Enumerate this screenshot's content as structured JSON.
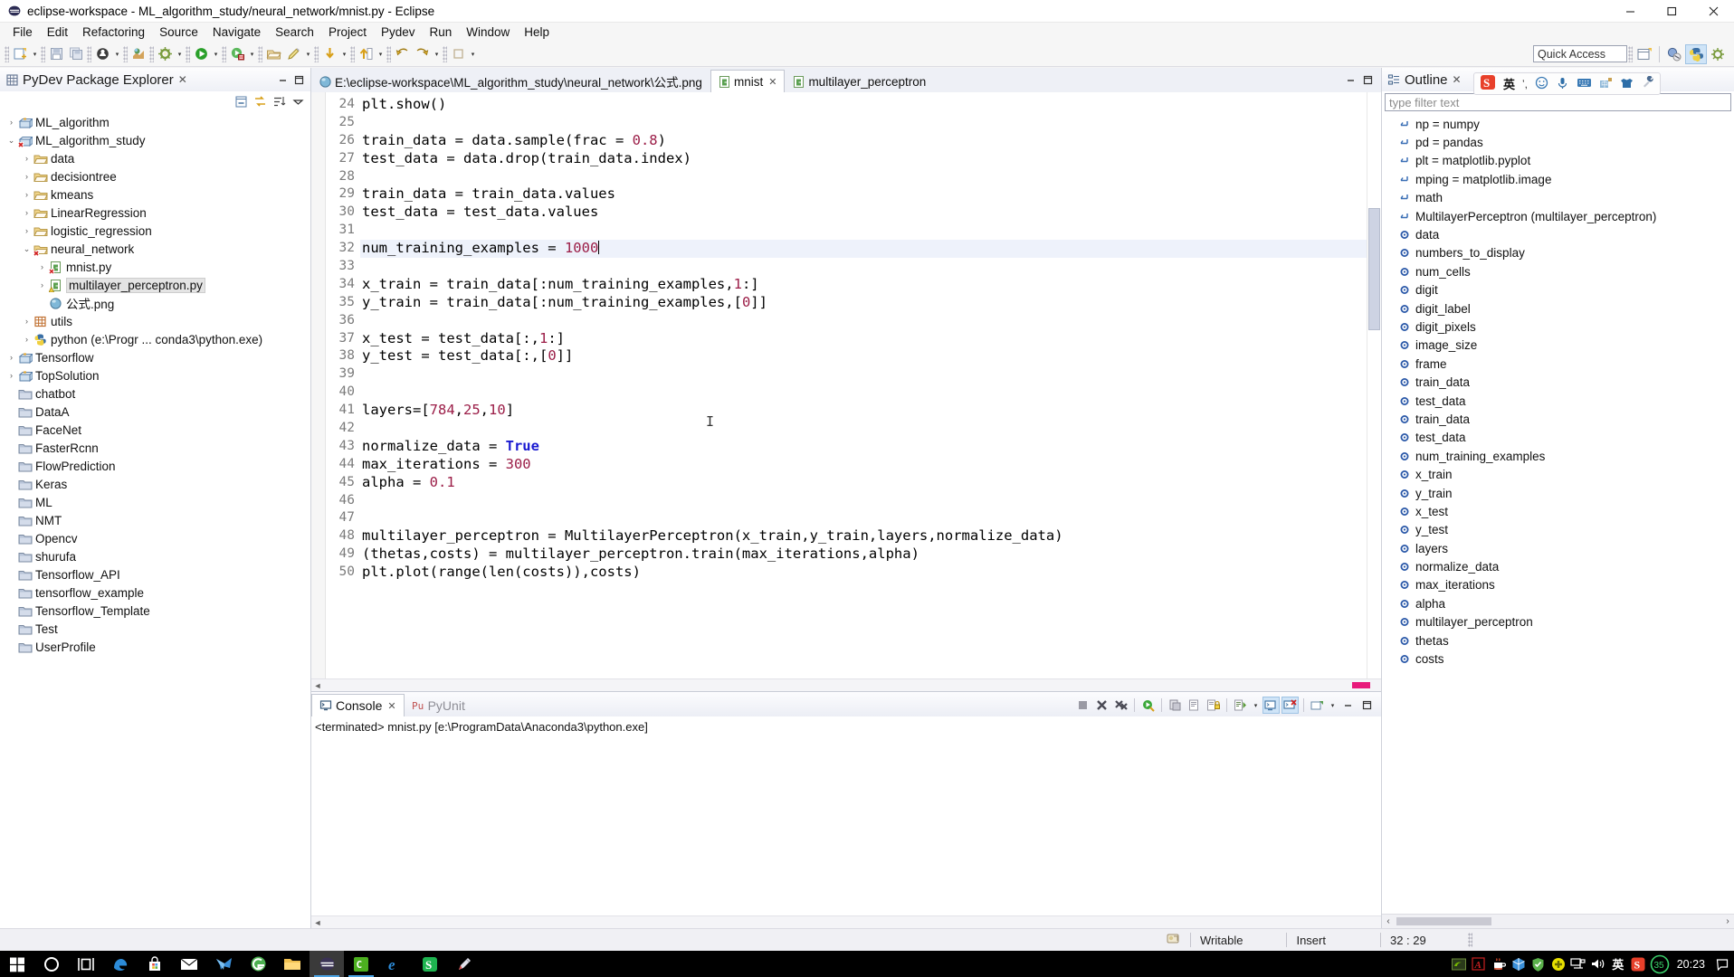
{
  "window": {
    "title": "eclipse-workspace - ML_algorithm_study/neural_network/mnist.py - Eclipse",
    "icon": "eclipse-icon",
    "minimize": "minimize-button",
    "maximize": "maximize-button",
    "close": "close-button"
  },
  "menubar": {
    "items": [
      "File",
      "Edit",
      "Refactoring",
      "Source",
      "Navigate",
      "Search",
      "Project",
      "Pydev",
      "Run",
      "Window",
      "Help"
    ]
  },
  "toolbar": {
    "quick_access_placeholder": "Quick Access",
    "buttons": [
      "new-wizard-icon",
      "save-icon",
      "save-all-icon",
      "print-icon",
      "globe-icon",
      "build-icon",
      "run-icon",
      "debug-icon",
      "open-type-icon",
      "pencil-icon",
      "next-annotation-icon",
      "previous-annotation-icon",
      "back-icon",
      "forward-icon",
      "pin-icon"
    ],
    "perspectives": [
      "open-perspective-icon",
      "java-perspective-icon",
      "pydev-perspective-icon",
      "debug-perspective-icon"
    ]
  },
  "explorer": {
    "title": "PyDev Package Explorer",
    "icon": "package-explorer-icon",
    "close_glyph": "✕",
    "header_tools": [
      "minimize-icon",
      "maximize-icon"
    ],
    "subtools": [
      "collapse-all-icon",
      "link-with-editor-icon",
      "sort-icon",
      "view-menu-icon"
    ],
    "tree": [
      {
        "label": "ML_algorithm",
        "indent": 0,
        "twist": "collapsed",
        "icon": "project-icon"
      },
      {
        "label": "ML_algorithm_study",
        "indent": 0,
        "twist": "expanded",
        "icon": "project-error-icon"
      },
      {
        "label": "data",
        "indent": 1,
        "twist": "collapsed",
        "icon": "folder-icon"
      },
      {
        "label": "decisiontree",
        "indent": 1,
        "twist": "collapsed",
        "icon": "folder-icon"
      },
      {
        "label": "kmeans",
        "indent": 1,
        "twist": "collapsed",
        "icon": "folder-icon"
      },
      {
        "label": "LinearRegression",
        "indent": 1,
        "twist": "collapsed",
        "icon": "folder-icon"
      },
      {
        "label": "logistic_regression",
        "indent": 1,
        "twist": "collapsed",
        "icon": "folder-icon"
      },
      {
        "label": "neural_network",
        "indent": 1,
        "twist": "expanded",
        "icon": "folder-error-icon"
      },
      {
        "label": "mnist.py",
        "indent": 2,
        "twist": "collapsed",
        "icon": "python-error-file-icon"
      },
      {
        "label": "multilayer_perceptron.py",
        "indent": 2,
        "twist": "collapsed",
        "icon": "python-warn-file-icon",
        "selected": true
      },
      {
        "label": "公式.png",
        "indent": 2,
        "twist": "none",
        "icon": "image-file-icon"
      },
      {
        "label": "utils",
        "indent": 1,
        "twist": "collapsed",
        "icon": "package-icon"
      },
      {
        "label": "python  (e:\\Progr ... conda3\\python.exe)",
        "indent": 1,
        "twist": "collapsed",
        "icon": "python-interpreter-icon"
      },
      {
        "label": "Tensorflow",
        "indent": 0,
        "twist": "collapsed",
        "icon": "project-icon"
      },
      {
        "label": "TopSolution",
        "indent": 0,
        "twist": "collapsed",
        "icon": "project-icon"
      },
      {
        "label": "chatbot",
        "indent": 0,
        "twist": "none",
        "icon": "closed-folder-icon"
      },
      {
        "label": "DataA",
        "indent": 0,
        "twist": "none",
        "icon": "closed-folder-icon"
      },
      {
        "label": "FaceNet",
        "indent": 0,
        "twist": "none",
        "icon": "closed-folder-icon"
      },
      {
        "label": "FasterRcnn",
        "indent": 0,
        "twist": "none",
        "icon": "closed-folder-icon"
      },
      {
        "label": "FlowPrediction",
        "indent": 0,
        "twist": "none",
        "icon": "closed-folder-icon"
      },
      {
        "label": "Keras",
        "indent": 0,
        "twist": "none",
        "icon": "closed-folder-icon"
      },
      {
        "label": "ML",
        "indent": 0,
        "twist": "none",
        "icon": "closed-folder-icon"
      },
      {
        "label": "NMT",
        "indent": 0,
        "twist": "none",
        "icon": "closed-folder-icon"
      },
      {
        "label": "Opencv",
        "indent": 0,
        "twist": "none",
        "icon": "closed-folder-icon"
      },
      {
        "label": "shurufa",
        "indent": 0,
        "twist": "none",
        "icon": "closed-folder-icon"
      },
      {
        "label": "Tensorflow_API",
        "indent": 0,
        "twist": "none",
        "icon": "closed-folder-icon"
      },
      {
        "label": "tensorflow_example",
        "indent": 0,
        "twist": "none",
        "icon": "closed-folder-icon"
      },
      {
        "label": "Tensorflow_Template",
        "indent": 0,
        "twist": "none",
        "icon": "closed-folder-icon"
      },
      {
        "label": "Test",
        "indent": 0,
        "twist": "none",
        "icon": "closed-folder-icon"
      },
      {
        "label": "UserProfile",
        "indent": 0,
        "twist": "none",
        "icon": "closed-folder-icon"
      }
    ]
  },
  "editor": {
    "tabs": [
      {
        "label": "E:\\eclipse-workspace\\ML_algorithm_study\\neural_network\\公式.png",
        "icon": "image-file-icon",
        "active": false,
        "closable": false
      },
      {
        "label": "mnist",
        "icon": "python-file-icon",
        "active": true,
        "closable": true,
        "close_glyph": "✕"
      },
      {
        "label": "multilayer_perceptron",
        "icon": "python-file-icon",
        "active": false,
        "closable": false
      }
    ],
    "minimize": "minimize-icon",
    "maximize": "maximize-icon",
    "first_line_number": 24,
    "highlight_line": 32,
    "lines": [
      {
        "n": 24,
        "tokens": [
          {
            "t": "plt.show()",
            "c": "plain"
          }
        ]
      },
      {
        "n": 25,
        "tokens": []
      },
      {
        "n": 26,
        "tokens": [
          {
            "t": "train_data = data.sample(frac = ",
            "c": "plain"
          },
          {
            "t": "0.8",
            "c": "num"
          },
          {
            "t": ")",
            "c": "plain"
          }
        ]
      },
      {
        "n": 27,
        "tokens": [
          {
            "t": "test_data = data.drop(train_data.index)",
            "c": "plain"
          }
        ]
      },
      {
        "n": 28,
        "tokens": []
      },
      {
        "n": 29,
        "tokens": [
          {
            "t": "train_data = train_data.values",
            "c": "plain"
          }
        ]
      },
      {
        "n": 30,
        "tokens": [
          {
            "t": "test_data = test_data.values",
            "c": "plain"
          }
        ]
      },
      {
        "n": 31,
        "tokens": []
      },
      {
        "n": 32,
        "tokens": [
          {
            "t": "num_training_examples = ",
            "c": "plain"
          },
          {
            "t": "1000",
            "c": "num"
          }
        ],
        "caret": true
      },
      {
        "n": 33,
        "tokens": []
      },
      {
        "n": 34,
        "tokens": [
          {
            "t": "x_train = train_data[:num_training_examples,",
            "c": "plain"
          },
          {
            "t": "1",
            "c": "num"
          },
          {
            "t": ":]",
            "c": "plain"
          }
        ]
      },
      {
        "n": 35,
        "tokens": [
          {
            "t": "y_train = train_data[:num_training_examples,[",
            "c": "plain"
          },
          {
            "t": "0",
            "c": "num"
          },
          {
            "t": "]]",
            "c": "plain"
          }
        ]
      },
      {
        "n": 36,
        "tokens": []
      },
      {
        "n": 37,
        "tokens": [
          {
            "t": "x_test = test_data[:,",
            "c": "plain"
          },
          {
            "t": "1",
            "c": "num"
          },
          {
            "t": ":]",
            "c": "plain"
          }
        ]
      },
      {
        "n": 38,
        "tokens": [
          {
            "t": "y_test = test_data[:,[",
            "c": "plain"
          },
          {
            "t": "0",
            "c": "num"
          },
          {
            "t": "]]",
            "c": "plain"
          }
        ]
      },
      {
        "n": 39,
        "tokens": []
      },
      {
        "n": 40,
        "tokens": []
      },
      {
        "n": 41,
        "tokens": [
          {
            "t": "layers=[",
            "c": "plain"
          },
          {
            "t": "784",
            "c": "num"
          },
          {
            "t": ",",
            "c": "plain"
          },
          {
            "t": "25",
            "c": "num"
          },
          {
            "t": ",",
            "c": "plain"
          },
          {
            "t": "10",
            "c": "num"
          },
          {
            "t": "]",
            "c": "plain"
          }
        ]
      },
      {
        "n": 42,
        "tokens": []
      },
      {
        "n": 43,
        "tokens": [
          {
            "t": "normalize_data = ",
            "c": "plain"
          },
          {
            "t": "True",
            "c": "kw"
          }
        ]
      },
      {
        "n": 44,
        "tokens": [
          {
            "t": "max_iterations = ",
            "c": "plain"
          },
          {
            "t": "300",
            "c": "num"
          }
        ]
      },
      {
        "n": 45,
        "tokens": [
          {
            "t": "alpha = ",
            "c": "plain"
          },
          {
            "t": "0.1",
            "c": "num"
          }
        ]
      },
      {
        "n": 46,
        "tokens": []
      },
      {
        "n": 47,
        "tokens": []
      },
      {
        "n": 48,
        "tokens": [
          {
            "t": "multilayer_perceptron = MultilayerPerceptron(x_train,y_train,layers,normalize_data)",
            "c": "plain"
          }
        ]
      },
      {
        "n": 49,
        "tokens": [
          {
            "t": "(thetas,costs) = multilayer_perceptron.train(max_iterations,alpha)",
            "c": "plain"
          }
        ]
      },
      {
        "n": 50,
        "tokens": [
          {
            "t": "plt.plot(range(len(costs)),costs)",
            "c": "plain"
          }
        ]
      }
    ]
  },
  "console": {
    "tabs": [
      {
        "label": "Console",
        "icon": "console-icon",
        "active": true,
        "close_glyph": "✕"
      },
      {
        "label": "PyUnit",
        "icon": "pyunit-icon",
        "active": false
      }
    ],
    "tools": [
      "terminate-icon",
      "remove-launch-icon",
      "remove-all-terminated-icon",
      "relaunch-icon",
      "clear-console-icon",
      "word-wrap-icon",
      "scroll-lock-icon",
      "show-console-icon",
      "pin-console-icon",
      "display-selected-console-icon",
      "open-console-icon"
    ],
    "output": "<terminated> mnist.py [e:\\ProgramData\\Anaconda3\\python.exe]"
  },
  "outline": {
    "title": "Outline",
    "icon": "outline-icon",
    "close_glyph": "✕",
    "filter_placeholder": "type filter text",
    "items": [
      {
        "label": "np = numpy",
        "icon": "import-icon"
      },
      {
        "label": "pd = pandas",
        "icon": "import-icon"
      },
      {
        "label": "plt = matplotlib.pyplot",
        "icon": "import-icon"
      },
      {
        "label": "mping = matplotlib.image",
        "icon": "import-icon"
      },
      {
        "label": "math",
        "icon": "import-icon"
      },
      {
        "label": "MultilayerPerceptron (multilayer_perceptron)",
        "icon": "import-icon"
      },
      {
        "label": "data",
        "icon": "variable-icon"
      },
      {
        "label": "numbers_to_display",
        "icon": "variable-icon"
      },
      {
        "label": "num_cells",
        "icon": "variable-icon"
      },
      {
        "label": "digit",
        "icon": "variable-icon"
      },
      {
        "label": "digit_label",
        "icon": "variable-icon"
      },
      {
        "label": "digit_pixels",
        "icon": "variable-icon"
      },
      {
        "label": "image_size",
        "icon": "variable-icon"
      },
      {
        "label": "frame",
        "icon": "variable-icon"
      },
      {
        "label": "train_data",
        "icon": "variable-icon"
      },
      {
        "label": "test_data",
        "icon": "variable-icon"
      },
      {
        "label": "train_data",
        "icon": "variable-icon"
      },
      {
        "label": "test_data",
        "icon": "variable-icon"
      },
      {
        "label": "num_training_examples",
        "icon": "variable-icon"
      },
      {
        "label": "x_train",
        "icon": "variable-icon"
      },
      {
        "label": "y_train",
        "icon": "variable-icon"
      },
      {
        "label": "x_test",
        "icon": "variable-icon"
      },
      {
        "label": "y_test",
        "icon": "variable-icon"
      },
      {
        "label": "layers",
        "icon": "variable-icon"
      },
      {
        "label": "normalize_data",
        "icon": "variable-icon"
      },
      {
        "label": "max_iterations",
        "icon": "variable-icon"
      },
      {
        "label": "alpha",
        "icon": "variable-icon"
      },
      {
        "label": "multilayer_perceptron",
        "icon": "variable-icon"
      },
      {
        "label": "thetas",
        "icon": "variable-icon"
      },
      {
        "label": "costs",
        "icon": "variable-icon"
      }
    ]
  },
  "ime": {
    "items": [
      "sogou-logo-icon",
      "chinese-mode-icon",
      "punctuation-icon",
      "emoji-icon",
      "voice-input-icon",
      "soft-keyboard-icon",
      "translate-icon",
      "skin-icon",
      "toolbox-icon"
    ],
    "chinese_label": "英"
  },
  "statusbar": {
    "icon": "smart-insert-icon",
    "writable": "Writable",
    "insert_mode": "Insert",
    "position": "32 : 29"
  },
  "taskbar": {
    "items": [
      "windows-start-icon",
      "cortana-icon",
      "task-view-icon",
      "edge-icon",
      "store-icon",
      "mail-icon",
      "foxmail-icon",
      "360-browser-icon",
      "file-explorer-icon",
      "eclipse-icon",
      "cmd-icon",
      "ie-icon",
      "sogou-icon",
      "paint-icon"
    ],
    "tray": [
      "nvidia-icon",
      "pdf-icon",
      "tea-icon",
      "box-icon",
      "shield-icon",
      "update-icon",
      "network-icon",
      "volume-icon"
    ],
    "ime_label": "英",
    "sogou_label": "sogou-tray-icon",
    "badge": "35",
    "clock": "20:23"
  }
}
